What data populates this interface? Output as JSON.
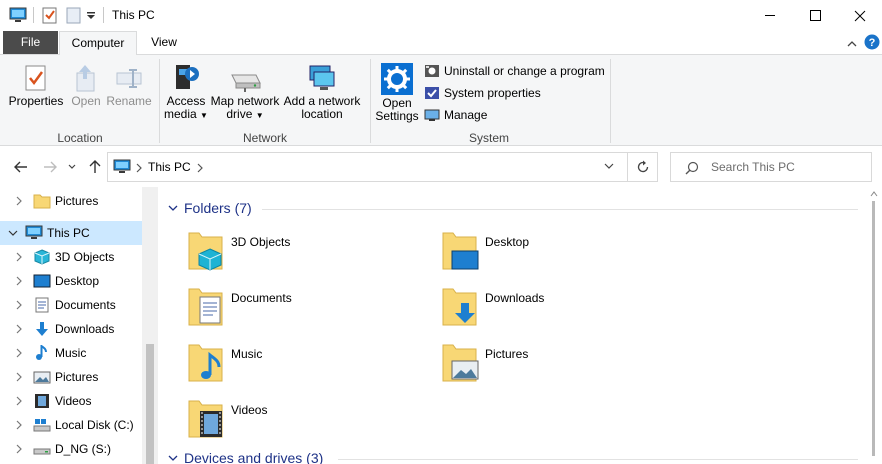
{
  "window": {
    "title": "This PC",
    "controls": {
      "minimize": "minimize-icon",
      "maximize": "maximize-icon",
      "close": "close-icon"
    }
  },
  "ribbon_tabs": {
    "file": "File",
    "computer": "Computer",
    "view": "View"
  },
  "ribbon": {
    "location": {
      "label": "Location",
      "properties": "Properties",
      "open": "Open",
      "rename": "Rename"
    },
    "network": {
      "label": "Network",
      "access_media_1": "Access",
      "access_media_2": "media",
      "map_drive_1": "Map network",
      "map_drive_2": "drive",
      "add_location_1": "Add a network",
      "add_location_2": "location"
    },
    "system": {
      "label": "System",
      "open_settings_1": "Open",
      "open_settings_2": "Settings",
      "uninstall": "Uninstall or change a program",
      "system_properties": "System properties",
      "manage": "Manage"
    }
  },
  "address": {
    "crumb": "This PC",
    "search_placeholder": "Search This PC"
  },
  "nav_pane": {
    "items": [
      {
        "label": "Pictures",
        "icon": "folder-icon"
      },
      {
        "label": "This PC",
        "icon": "computer-icon",
        "selected": true
      },
      {
        "label": "3D Objects",
        "icon": "3d-objects-icon"
      },
      {
        "label": "Desktop",
        "icon": "desktop-icon"
      },
      {
        "label": "Documents",
        "icon": "documents-icon"
      },
      {
        "label": "Downloads",
        "icon": "downloads-icon"
      },
      {
        "label": "Music",
        "icon": "music-icon"
      },
      {
        "label": "Pictures",
        "icon": "pictures-icon"
      },
      {
        "label": "Videos",
        "icon": "videos-icon"
      },
      {
        "label": "Local Disk (C:)",
        "icon": "local-disk-icon"
      },
      {
        "label": "D_NG (S:)",
        "icon": "drive-icon"
      }
    ]
  },
  "content": {
    "folders_header": "Folders (7)",
    "devices_header": "Devices and drives (3)",
    "folders": [
      {
        "label": "3D Objects",
        "icon": "3d-objects-folder-icon"
      },
      {
        "label": "Desktop",
        "icon": "desktop-folder-icon"
      },
      {
        "label": "Documents",
        "icon": "documents-folder-icon"
      },
      {
        "label": "Downloads",
        "icon": "downloads-folder-icon"
      },
      {
        "label": "Music",
        "icon": "music-folder-icon"
      },
      {
        "label": "Pictures",
        "icon": "pictures-folder-icon"
      },
      {
        "label": "Videos",
        "icon": "videos-folder-icon"
      }
    ]
  },
  "colors": {
    "accent": "#0078d7",
    "selection": "#cce8ff",
    "file_tab": "#4b4b4b",
    "section_header": "#1e3287",
    "folder_yellow": "#f8d775"
  }
}
